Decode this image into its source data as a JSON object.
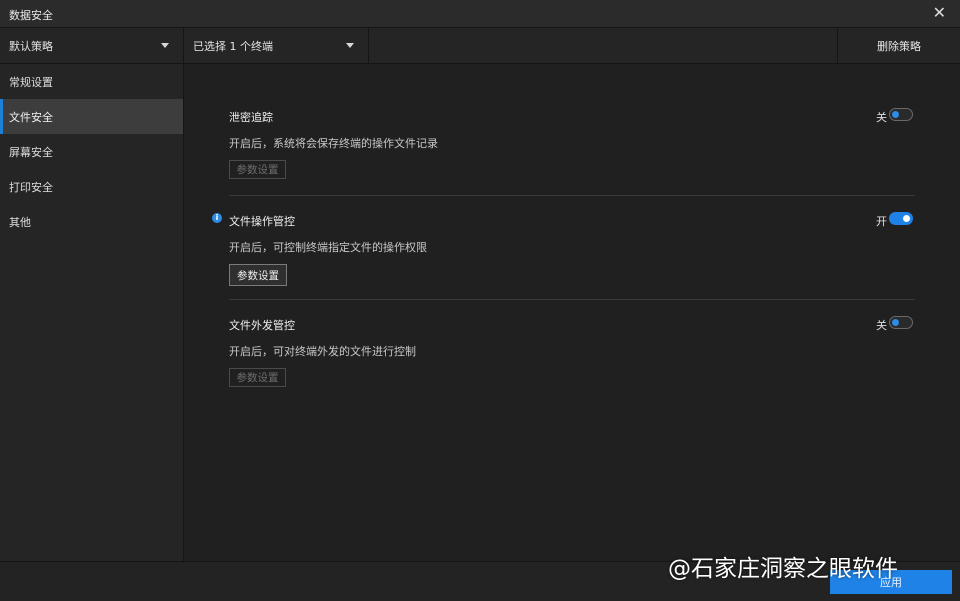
{
  "window": {
    "title": "数据安全"
  },
  "toolbar": {
    "policy_label": "默认策略",
    "terminal_label": "已选择 1 个终端",
    "delete_label": "删除策略"
  },
  "sidebar": {
    "items": [
      {
        "label": "常规设置"
      },
      {
        "label": "文件安全"
      },
      {
        "label": "屏幕安全"
      },
      {
        "label": "打印安全"
      },
      {
        "label": "其他"
      }
    ],
    "active_index": 1
  },
  "sections": [
    {
      "name": "泄密追踪",
      "desc": "开启后，系统将会保存终端的操作文件记录",
      "toggle_label": "关",
      "on": false,
      "button": "参数设置",
      "button_enabled": false
    },
    {
      "name": "文件操作管控",
      "desc": "开启后，可控制终端指定文件的操作权限",
      "toggle_label": "开",
      "on": true,
      "button": "参数设置",
      "button_enabled": true
    },
    {
      "name": "文件外发管控",
      "desc": "开启后，可对终端外发的文件进行控制",
      "toggle_label": "关",
      "on": false,
      "button": "参数设置",
      "button_enabled": false
    }
  ],
  "footer": {
    "apply_label": "应用"
  },
  "watermark": "@石家庄洞察之眼软件",
  "colors": {
    "accent": "#1f82e6",
    "background": "#202020",
    "panel": "#252525"
  }
}
